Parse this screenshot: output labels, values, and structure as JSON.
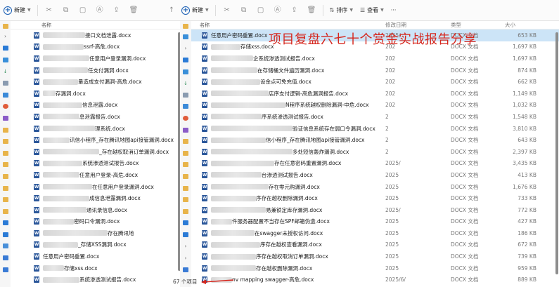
{
  "toolbar_left": {
    "new_label": "新建"
  },
  "toolbar_right": {
    "new_label": "新建",
    "sort_label": "排序",
    "view_label": "查看",
    "more_label": "···"
  },
  "left_pane": {
    "col_name": "名称",
    "files": [
      "接口文档泄露.docx",
      "ssrf-高危.docx",
      "任意用户登录漏洞.docx",
      "任支付漏洞.docx",
      "量造成支付漏洞-高危.docx",
      "存漏洞.docx",
      "信息泄露.docx",
      "息泄露报告.docx",
      "理系统.docx",
      "讯信小程序_存在腾讯地图api接管漏洞.docx",
      "_存在越权取消订单漏洞.docx",
      "系统渗透测试报告.docx",
      "任意用户登录-高危.docx",
      "在任意用户登录漏洞.docx",
      "成信息泄露漏洞.docx",
      "通讯录信息.docx",
      "密码口令漏洞.docx",
      "存在腾讯地",
      "_存储XSS漏洞.docx",
      "任意用户密码重置.docx",
      "存储xss.docx",
      "系统渗透测试报告.docx"
    ]
  },
  "right_pane": {
    "col_name": "名称",
    "col_date": "修改日期",
    "col_type": "类型",
    "col_size": "大小",
    "files": [
      {
        "name": "任意用户密码重置.docx",
        "date": "2025/",
        "type": "DOCX 文档",
        "size": "653 KB"
      },
      {
        "name": "存储xss.docx",
        "date": "202",
        "type": "DOCX 文档",
        "size": "1,697 KB"
      },
      {
        "name": "企系统渗透测试报告.docx",
        "date": "202",
        "type": "DOCX 文档",
        "size": "1,697 KB"
      },
      {
        "name": "在存储桶文件遍历漏洞.docx",
        "date": "202",
        "type": "DOCX 文档",
        "size": "874 KB"
      },
      {
        "name": "设金点可免充值.docx",
        "date": "202",
        "type": "DOCX 文档",
        "size": "662 KB"
      },
      {
        "name": "店序支付逻辑-高危漏洞报告.docx",
        "date": "202",
        "type": "DOCX 文档",
        "size": "1,149 KB"
      },
      {
        "name": "N程序系统越权删除漏洞-中危.docx",
        "date": "202",
        "type": "DOCX 文档",
        "size": "1,032 KB"
      },
      {
        "name": "序系统渗透测试报告.docx",
        "date": "2",
        "type": "DOCX 文档",
        "size": "1,548 KB"
      },
      {
        "name": "验证信息系统存在弱口令漏洞.docx",
        "date": "2",
        "type": "DOCX 文档",
        "size": "3,810 KB"
      },
      {
        "name": "信小程序_存在腾讯地图api接管漏洞.docx",
        "date": "2",
        "type": "DOCX 文档",
        "size": "643 KB"
      },
      {
        "name": "多处短信轰炸漏洞.docx",
        "date": "2",
        "type": "DOCX 文档",
        "size": "2,397 KB"
      },
      {
        "name": "存在任意密码重置漏洞.docx",
        "date": "2025/",
        "type": "DOCX 文档",
        "size": "3,435 KB"
      },
      {
        "name": "台渗透测试报告.docx",
        "date": "2025",
        "type": "DOCX 文档",
        "size": "413 KB"
      },
      {
        "name": "存在零元购漏洞.docx",
        "date": "2025",
        "type": "DOCX 文档",
        "size": "1,676 KB"
      },
      {
        "name": "序存在越权删除漏洞.docx",
        "date": "2025",
        "type": "DOCX 文档",
        "size": "733 KB"
      },
      {
        "name": "易兼锁定库存漏洞.docx",
        "date": "2025/",
        "type": "DOCX 文档",
        "size": "772 KB"
      },
      {
        "name": "件服务器配置不当存在SPF邮箱伪造.docx",
        "date": "2025",
        "type": "DOCX 文档",
        "size": "427 KB"
      },
      {
        "name": "在swagger未授权访问.docx",
        "date": "2025",
        "type": "DOCX 文档",
        "size": "186 KB"
      },
      {
        "name": "序存在越权查看漏洞.docx",
        "date": "2025",
        "type": "DOCX 文档",
        "size": "672 KB"
      },
      {
        "name": "序存在越权取消订单漏洞.docx",
        "date": "2025",
        "type": "DOCX 文档",
        "size": "739 KB"
      },
      {
        "name": "存在越权删除漏洞.docx",
        "date": "2025",
        "type": "DOCX 文档",
        "size": "959 KB"
      },
      {
        "name": "nv mapping swagger-高危.docx",
        "date": "2025/6/",
        "type": "DOCX 文档",
        "size": "889 KB"
      }
    ]
  },
  "status": {
    "item_count": "67 个项目"
  },
  "overlay": {
    "title": "项目复盘六七十个赏金实战报告分享"
  },
  "colors": {
    "accent": "#1a5fb4",
    "word": "#2b579a",
    "annotation": "#d6271e",
    "selected": "#cce4f7"
  }
}
